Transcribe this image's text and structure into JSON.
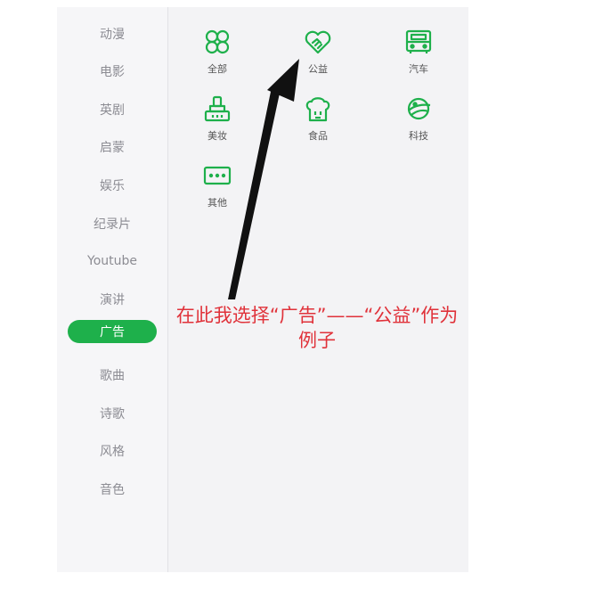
{
  "sidebar": {
    "items": [
      {
        "label": "动漫"
      },
      {
        "label": "电影"
      },
      {
        "label": "英剧"
      },
      {
        "label": "启蒙"
      },
      {
        "label": "娱乐"
      },
      {
        "label": "纪录片"
      },
      {
        "label": "Youtube"
      },
      {
        "label": "演讲"
      },
      {
        "label": "广告",
        "active": true
      },
      {
        "label": "歌曲"
      },
      {
        "label": "诗歌"
      },
      {
        "label": "风格"
      },
      {
        "label": "音色"
      }
    ]
  },
  "grid": {
    "items": [
      {
        "label": "全部",
        "icon": "clover-icon"
      },
      {
        "label": "公益",
        "icon": "heart-handshake-icon"
      },
      {
        "label": "汽车",
        "icon": "car-icon"
      },
      {
        "label": "美妆",
        "icon": "makeup-icon"
      },
      {
        "label": "食品",
        "icon": "food-icon"
      },
      {
        "label": "科技",
        "icon": "planet-icon"
      },
      {
        "label": "其他",
        "icon": "more-icon"
      }
    ]
  },
  "annotation": {
    "text": "在此我选择“广告”——“公益”作为例子"
  },
  "colors": {
    "accent": "#1eb04b",
    "annotation": "#e0323a",
    "arrow": "#111111"
  }
}
